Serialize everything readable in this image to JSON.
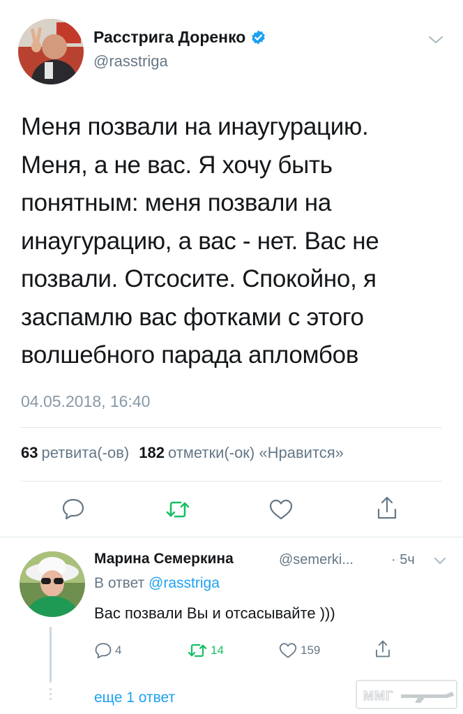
{
  "tweet": {
    "author_name": "Расстрига Доренко",
    "author_handle": "@rasstriga",
    "text_lines": [
      "Меня позвали на инаугурацию.",
      "Меня, а не вас. Я хочу быть",
      "понятным: меня позвали на",
      "инаугурацию, а вас - нет. Вас не",
      "позвали. Отсосите. Спокойно, я",
      "заспамлю вас фотками с этого",
      "волшебного парада апломбов"
    ],
    "timestamp": "04.05.2018, 16:40",
    "stats": {
      "retweets_count": "63",
      "retweets_label": "ретвита(-ов)",
      "likes_count": "182",
      "likes_label": "отметки(-ок) «Нравится»"
    }
  },
  "reply": {
    "author_name": "Марина Семеркина",
    "author_handle": "@semerki...",
    "time": "· 5ч",
    "reply_to_prefix": "В ответ",
    "reply_to_handle": "@rasstriga",
    "text": "Вас позвали Вы и отсасывайте )))",
    "counts": {
      "replies": "4",
      "retweets": "14",
      "likes": "159"
    },
    "more_replies": "еще 1 ответ"
  },
  "watermark": {
    "text": "ММГ"
  },
  "colors": {
    "accent": "#1da1f2",
    "retweet": "#17bf63",
    "muted": "#657786",
    "text": "#14171a",
    "divider": "#e1e8ed"
  },
  "icons": [
    "verified-icon",
    "chevron-down-icon",
    "reply-icon",
    "retweet-icon",
    "like-icon",
    "share-icon"
  ]
}
